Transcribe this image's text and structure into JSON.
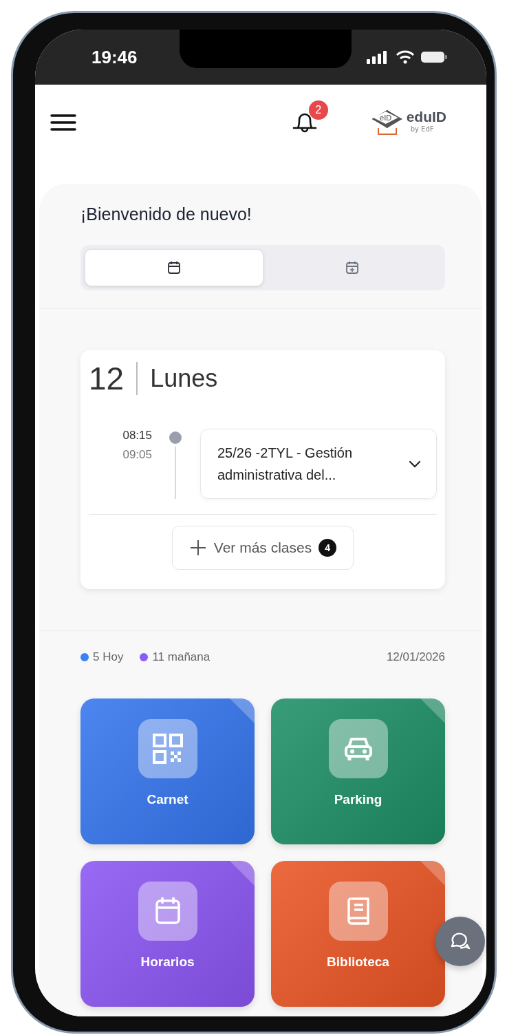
{
  "status_bar": {
    "time": "19:46"
  },
  "header": {
    "notification_count": "2",
    "logo": {
      "mark": "eID",
      "name": "eduID",
      "tagline": "by EdF"
    }
  },
  "welcome": {
    "title": "¡Bienvenido de nuevo!"
  },
  "tabs": [
    {
      "kind": "calendar",
      "selected": true
    },
    {
      "kind": "calendar-plus",
      "selected": false
    }
  ],
  "day_card": {
    "day_number": "12",
    "weekday": "Lunes",
    "classes": [
      {
        "start": "08:15",
        "end": "09:05",
        "title": "25/26 -2TYL - Gestión administrativa del...",
        "expanded": false
      }
    ],
    "more_button": {
      "label": "Ver más clases",
      "count": "4"
    }
  },
  "legend": [
    {
      "count": "5",
      "label": "Hoy",
      "color": "#3b82f6"
    },
    {
      "count": "11",
      "label": "mañana",
      "color": "#8b5cf6"
    }
  ],
  "date": "12/01/2026",
  "tiles": [
    {
      "label": "Carnet",
      "kind": "qr",
      "color": "#3575ee"
    },
    {
      "label": "Parking",
      "kind": "car",
      "color": "#1e8f66"
    },
    {
      "label": "Horarios",
      "kind": "calendar",
      "color": "#8b55f3"
    },
    {
      "label": "Biblioteca",
      "kind": "book",
      "color": "#ea5424"
    }
  ]
}
